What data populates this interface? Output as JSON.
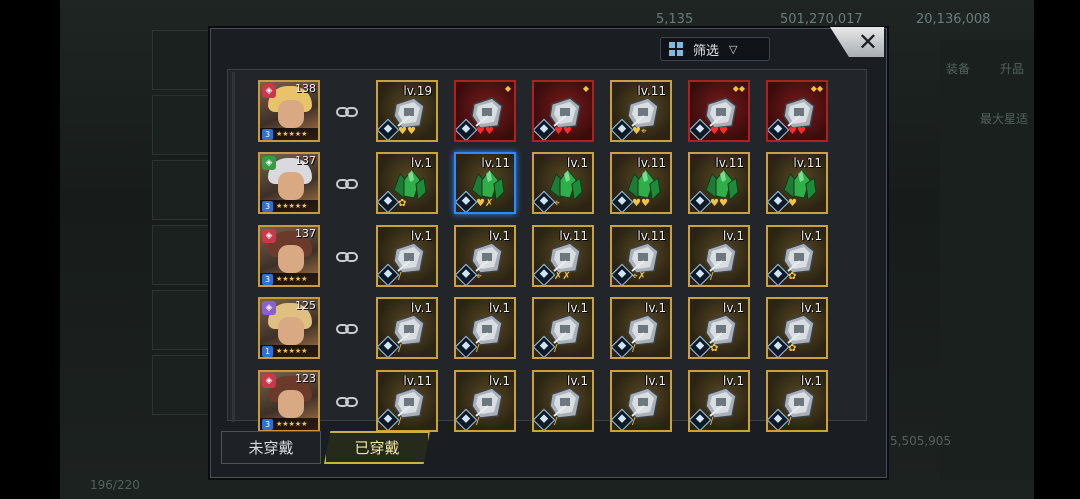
{
  "background": {
    "resource_1": "5,135",
    "resource_2": "501,270,017",
    "resource_3": "20,136,008",
    "right_tab_1": "装备",
    "right_tab_2": "升品",
    "right_title": "最大星适",
    "bottom_value": "5,505,905",
    "bottom_left_count": "196/220"
  },
  "dialog": {
    "filter_label": "筛选",
    "filter_arrow": "▽",
    "close_label": "✕"
  },
  "tabs": [
    {
      "label": "未穿戴",
      "active": false
    },
    {
      "label": "已穿戴",
      "active": true
    }
  ],
  "colors": {
    "gold_frame": "#c9a23e",
    "red_frame": "#b11f1f",
    "select_blue": "#2a8cff",
    "active_tab": "#c8b24b"
  },
  "rows": [
    {
      "hero": {
        "level": "138",
        "rank": "3",
        "element": "fire",
        "element_color": "#c8374a",
        "hair": "#e8c36a"
      },
      "slots": [
        {
          "lv": "lv.19",
          "kind": "gray",
          "frame": "gold",
          "extras": "gold-hearts"
        },
        {
          "lv": "",
          "kind": "gray",
          "frame": "red",
          "extras": "red-hearts",
          "corner": "◆"
        },
        {
          "lv": "",
          "kind": "gray",
          "frame": "red",
          "extras": "red-hearts",
          "corner": "◆"
        },
        {
          "lv": "lv.11",
          "kind": "gray",
          "frame": "gold",
          "extras": "heart-target"
        },
        {
          "lv": "",
          "kind": "gray",
          "frame": "red",
          "extras": "red-hearts",
          "corner": "◆◆"
        },
        {
          "lv": "",
          "kind": "gray",
          "frame": "red",
          "extras": "red-hearts",
          "corner": "◆◆"
        }
      ]
    },
    {
      "hero": {
        "level": "137",
        "rank": "3",
        "element": "wind",
        "element_color": "#3a9a48",
        "hair": "#d9d9de"
      },
      "slots": [
        {
          "lv": "lv.1",
          "kind": "green",
          "frame": "gold",
          "extras": "flower"
        },
        {
          "lv": "lv.11",
          "kind": "green",
          "frame": "gold",
          "selected": true,
          "extras": "heart-runner"
        },
        {
          "lv": "lv.1",
          "kind": "green",
          "frame": "gold",
          "extras": "target"
        },
        {
          "lv": "lv.11",
          "kind": "green",
          "frame": "gold",
          "extras": "gold-hearts"
        },
        {
          "lv": "lv.11",
          "kind": "green",
          "frame": "gold",
          "extras": "gold-hearts"
        },
        {
          "lv": "lv.11",
          "kind": "green",
          "frame": "gold",
          "extras": "heart"
        }
      ]
    },
    {
      "hero": {
        "level": "137",
        "rank": "3",
        "element": "fire",
        "element_color": "#c8374a",
        "hair": "#6b3a2a"
      },
      "slots": [
        {
          "lv": "lv.1",
          "kind": "gray",
          "frame": "gold",
          "extras": "sword"
        },
        {
          "lv": "lv.1",
          "kind": "gray",
          "frame": "gold",
          "extras": "target"
        },
        {
          "lv": "lv.11",
          "kind": "gray",
          "frame": "gold",
          "extras": "runners"
        },
        {
          "lv": "lv.11",
          "kind": "gray",
          "frame": "gold",
          "extras": "target-runner"
        },
        {
          "lv": "lv.1",
          "kind": "gray",
          "frame": "gold",
          "extras": "sword"
        },
        {
          "lv": "lv.1",
          "kind": "gray",
          "frame": "gold",
          "extras": "flower"
        }
      ]
    },
    {
      "hero": {
        "level": "125",
        "rank": "1",
        "element": "light",
        "element_color": "#8a5fd0",
        "hair": "#e0c080"
      },
      "slots": [
        {
          "lv": "lv.1",
          "kind": "gray",
          "frame": "gold",
          "extras": "sword"
        },
        {
          "lv": "lv.1",
          "kind": "gray",
          "frame": "gold",
          "extras": "sword"
        },
        {
          "lv": "lv.1",
          "kind": "gray",
          "frame": "gold",
          "extras": "sword"
        },
        {
          "lv": "lv.1",
          "kind": "gray",
          "frame": "gold",
          "extras": "sword"
        },
        {
          "lv": "lv.1",
          "kind": "gray",
          "frame": "gold",
          "extras": "flower"
        },
        {
          "lv": "lv.1",
          "kind": "gray",
          "frame": "gold",
          "extras": "flower"
        }
      ]
    },
    {
      "hero": {
        "level": "123",
        "rank": "3",
        "element": "fire",
        "element_color": "#c8374a",
        "hair": "#6b3a2a"
      },
      "slots": [
        {
          "lv": "lv.11",
          "kind": "gray",
          "frame": "gold",
          "extras": "sword"
        },
        {
          "lv": "lv.1",
          "kind": "gray",
          "frame": "gold",
          "extras": "sword"
        },
        {
          "lv": "lv.1",
          "kind": "gray",
          "frame": "gold",
          "extras": "sword"
        },
        {
          "lv": "lv.1",
          "kind": "gray",
          "frame": "gold",
          "extras": "sword"
        },
        {
          "lv": "lv.1",
          "kind": "gray",
          "frame": "gold",
          "extras": "sword"
        },
        {
          "lv": "lv.1",
          "kind": "gray",
          "frame": "gold",
          "extras": "sword"
        }
      ]
    }
  ]
}
